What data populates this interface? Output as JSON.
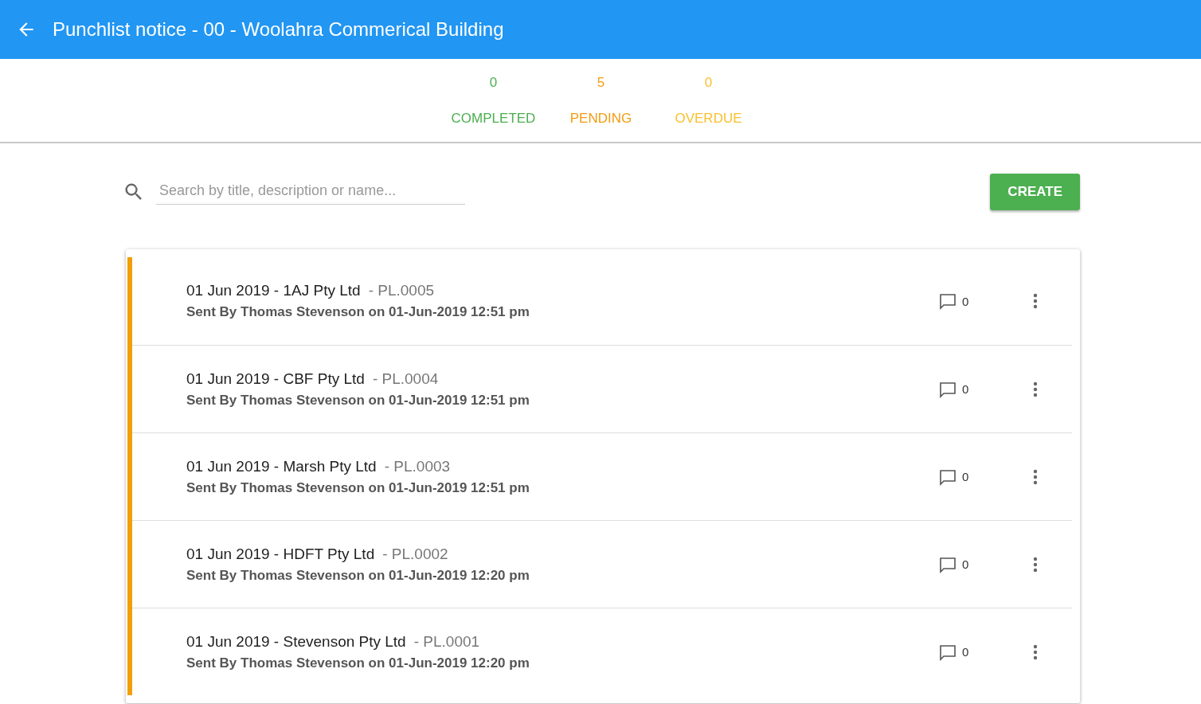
{
  "header": {
    "title": "Punchlist notice - 00 - Woolahra Commerical Building"
  },
  "stats": [
    {
      "count": "0",
      "label": "COMPLETED",
      "color": "#4caf50"
    },
    {
      "count": "5",
      "label": "PENDING",
      "color": "#f39c12"
    },
    {
      "count": "0",
      "label": "OVERDUE",
      "color": "#fbc02d"
    }
  ],
  "search": {
    "placeholder": "Search by title, description or name..."
  },
  "create_button": "CREATE",
  "items": [
    {
      "title": "01 Jun 2019 - 1AJ Pty Ltd",
      "code": "- PL.0005",
      "sent": "Sent By Thomas Stevenson on 01-Jun-2019 12:51 pm",
      "comments": "0",
      "color": "#f29f05"
    },
    {
      "title": "01 Jun 2019 - CBF Pty Ltd",
      "code": "- PL.0004",
      "sent": "Sent By Thomas Stevenson on 01-Jun-2019 12:51 pm",
      "comments": "0",
      "color": "#f29f05"
    },
    {
      "title": "01 Jun 2019 - Marsh Pty Ltd",
      "code": "- PL.0003",
      "sent": "Sent By Thomas Stevenson on 01-Jun-2019 12:51 pm",
      "comments": "0",
      "color": "#f29f05"
    },
    {
      "title": "01 Jun 2019 - HDFT Pty Ltd",
      "code": "- PL.0002",
      "sent": "Sent By Thomas Stevenson on 01-Jun-2019 12:20 pm",
      "comments": "0",
      "color": "#f29f05"
    },
    {
      "title": "01 Jun 2019 - Stevenson Pty Ltd",
      "code": "- PL.0001",
      "sent": "Sent By Thomas Stevenson on 01-Jun-2019 12:20 pm",
      "comments": "0",
      "color": "#f29f05"
    }
  ]
}
